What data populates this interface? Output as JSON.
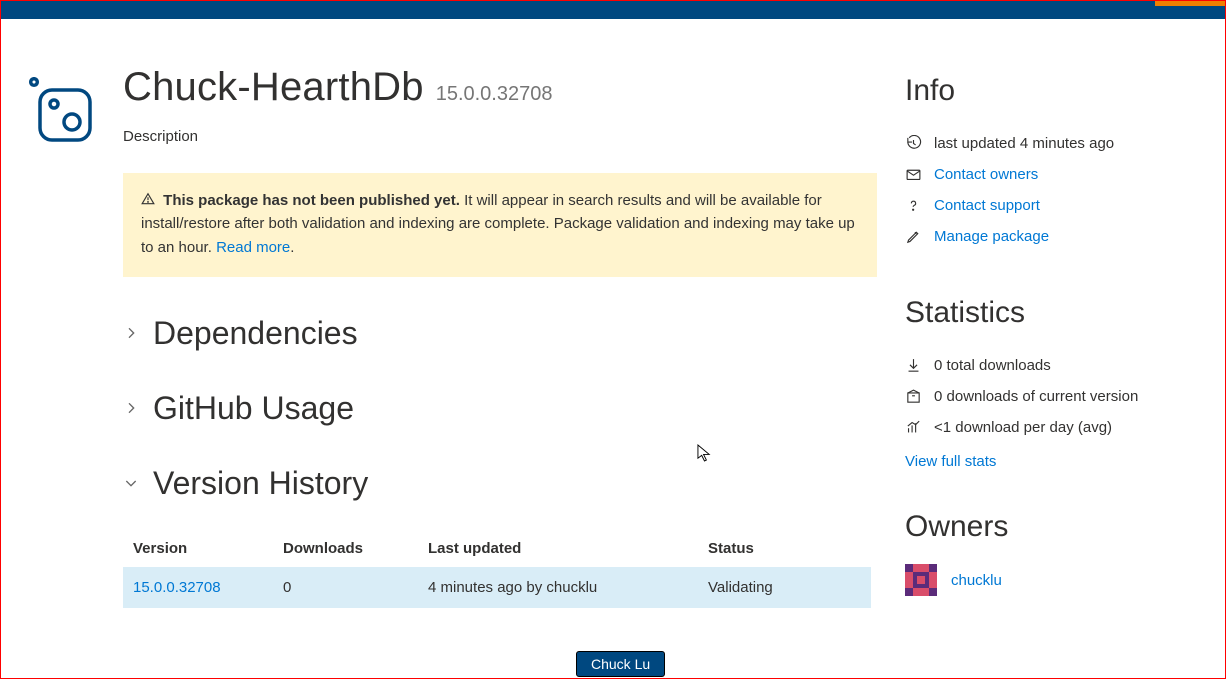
{
  "header": {
    "title": "Chuck-HearthDb",
    "version": "15.0.0.32708",
    "description": "Description"
  },
  "notice": {
    "bold": "This package has not been published yet.",
    "rest": " It will appear in search results and will be available for install/restore after both validation and indexing are complete. Package validation and indexing may take up to an hour. ",
    "read_more": "Read more"
  },
  "sections": {
    "dependencies": "Dependencies",
    "github_usage": "GitHub Usage",
    "version_history": "Version History"
  },
  "table": {
    "headers": {
      "version": "Version",
      "downloads": "Downloads",
      "last_updated": "Last updated",
      "status": "Status"
    },
    "rows": [
      {
        "version": "15.0.0.32708",
        "downloads": "0",
        "last_updated": "4 minutes ago by chucklu",
        "status": "Validating"
      }
    ]
  },
  "info": {
    "title": "Info",
    "last_updated": "last updated 4 minutes ago",
    "contact_owners": "Contact owners",
    "contact_support": "Contact support",
    "manage_package": "Manage package"
  },
  "stats": {
    "title": "Statistics",
    "total_downloads": "0 total downloads",
    "current_downloads": "0 downloads of current version",
    "per_day": "<1 download per day (avg)",
    "view_full": "View full stats"
  },
  "owners": {
    "title": "Owners",
    "name": "chucklu"
  },
  "tooltip": "Chuck Lu"
}
